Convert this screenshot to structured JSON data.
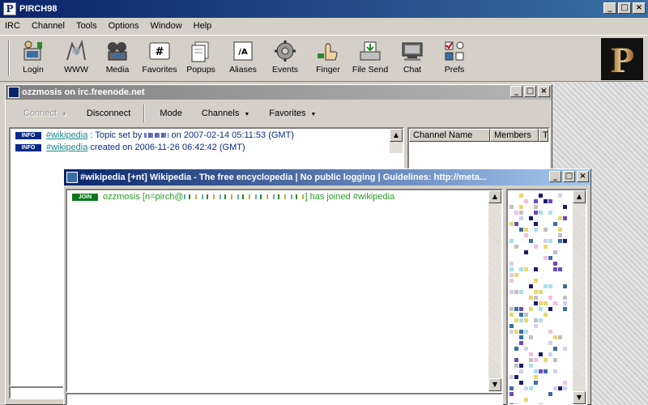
{
  "app": {
    "title": "PIRCH98",
    "logo_letter": "P",
    "colors": {
      "titlebar": "#0a246a",
      "info_badge": "#0a2a8a",
      "join_badge": "#0a7a1a",
      "link": "#1a8a8a",
      "join_text": "#2a9a2a"
    }
  },
  "window_controls": {
    "minimize": "_",
    "maximize": "□",
    "close": "×"
  },
  "menu": [
    "IRC",
    "Channel",
    "Tools",
    "Options",
    "Window",
    "Help"
  ],
  "toolbar": [
    {
      "label": "Login",
      "icon": "login-icon"
    },
    {
      "label": "WWW",
      "icon": "www-icon"
    },
    {
      "label": "Media",
      "icon": "media-icon"
    },
    {
      "label": "Favorites",
      "icon": "favorites-icon"
    },
    {
      "label": "Popups",
      "icon": "popups-icon"
    },
    {
      "label": "Aliases",
      "icon": "aliases-icon"
    },
    {
      "label": "Events",
      "icon": "events-icon"
    },
    {
      "label": "Finger",
      "icon": "finger-icon"
    },
    {
      "label": "File Send",
      "icon": "file-send-icon"
    },
    {
      "label": "Chat",
      "icon": "chat-icon"
    },
    {
      "label": "Prefs",
      "icon": "prefs-icon"
    }
  ],
  "server_window": {
    "title": "ozzmosis on irc.freenode.net",
    "tools": {
      "connect": "Connect",
      "disconnect": "Disconnect",
      "mode": "Mode",
      "channels": "Channels",
      "favorites": "Favorites"
    },
    "messages": [
      {
        "badge": "INFO",
        "channel": "#wikipedia",
        "text_a": " : Topic set by ",
        "text_b": " on 2007-02-14 05:11:53 (GMT)"
      },
      {
        "badge": "INFO",
        "channel": "#wikipedia",
        "text": " created on 2006-11-26 06:42:42 (GMT)"
      }
    ],
    "channel_list_headers": [
      "Channel Name",
      "Members",
      "T"
    ]
  },
  "channel_window": {
    "title": "#wikipedia [+nt] Wikipedia - The free encyclopedia | No public logging | Guidelines: http://meta...",
    "join": {
      "badge": "JOIN",
      "nick": "ozzmosis",
      "host_prefix": " [n=pirch@",
      "text": "] has joined #wikipedia"
    }
  }
}
